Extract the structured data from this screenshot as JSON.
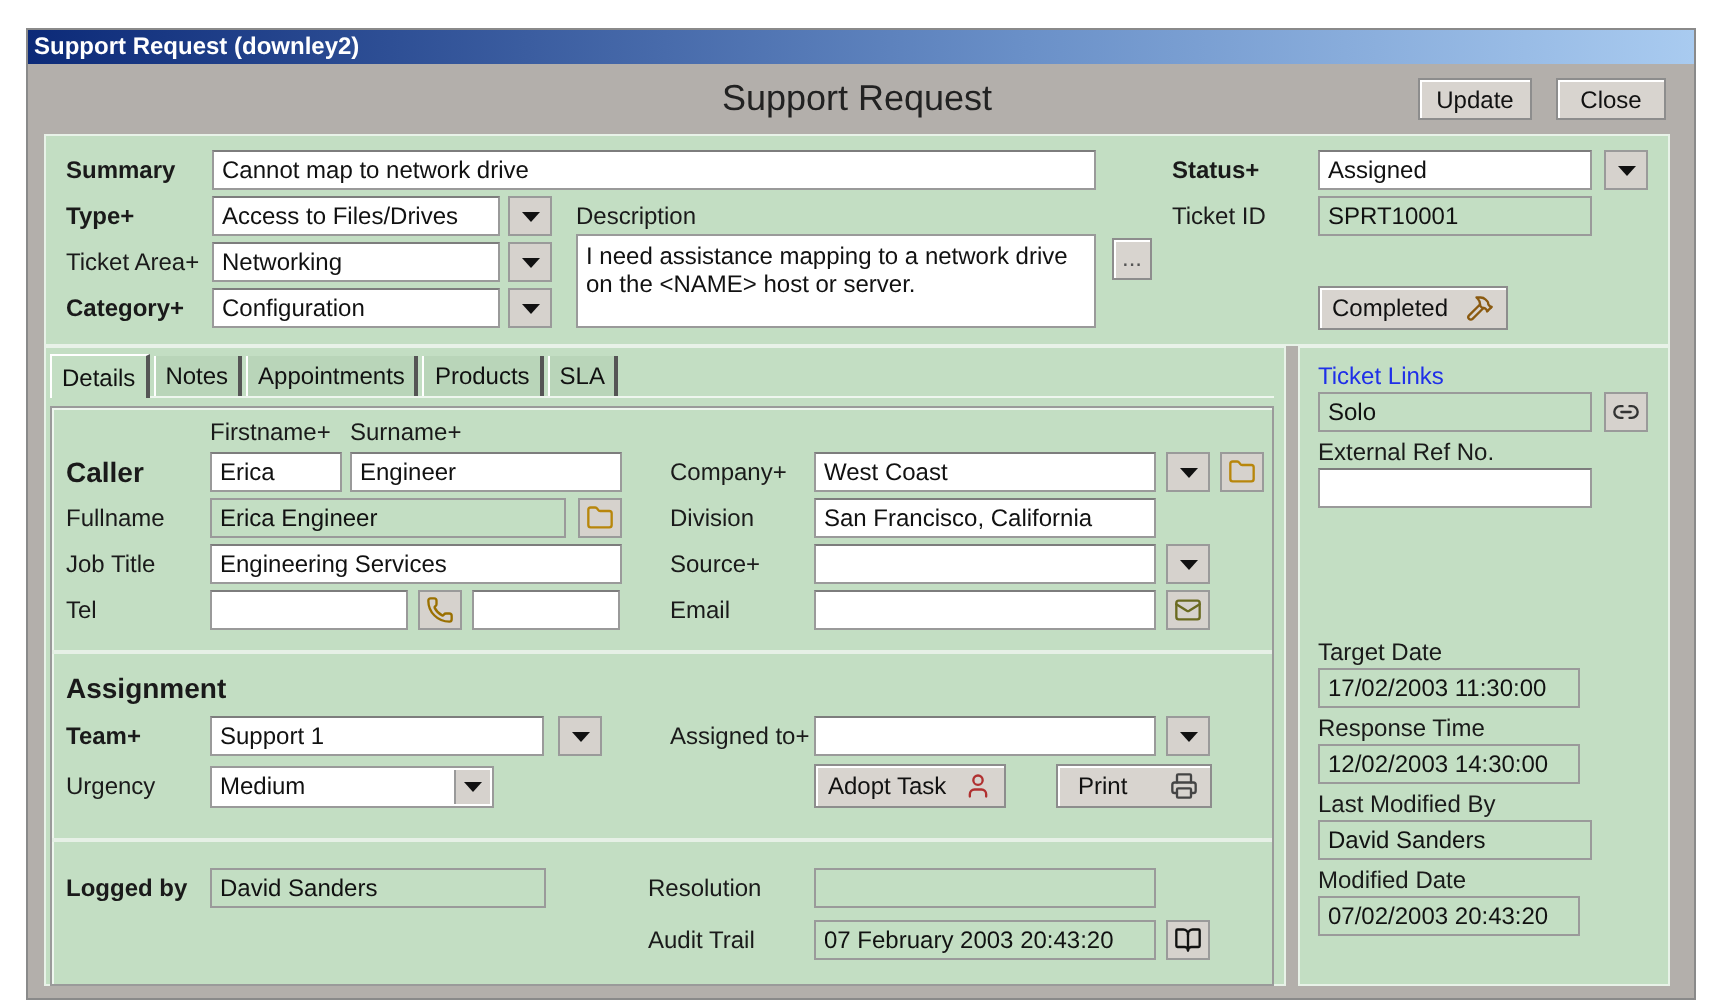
{
  "window": {
    "title": "Support Request (downley2)"
  },
  "header": {
    "title": "Support Request",
    "update_button": "Update",
    "close_button": "Close"
  },
  "summary": {
    "label": "Summary",
    "value": "Cannot map to network drive",
    "read_only": false
  },
  "type": {
    "label": "Type+",
    "value": "Access to Files/Drives",
    "read_only": false
  },
  "ticket_area": {
    "label": "Ticket Area+",
    "value": "Networking",
    "read_only": false
  },
  "category": {
    "label": "Category+",
    "value": "Configuration",
    "read_only": false
  },
  "description": {
    "label": "Description",
    "value": "I need assistance mapping to a network drive on the <NAME> host or server.",
    "read_only": false,
    "more_button": "..."
  },
  "status": {
    "label": "Status+",
    "value": "Assigned",
    "read_only": false
  },
  "ticket_id": {
    "label": "Ticket ID",
    "value": "SPRT10001",
    "read_only": true
  },
  "completed_button": "Completed",
  "tabs": [
    {
      "label": "Details",
      "selected": true
    },
    {
      "label": "Notes",
      "selected": false
    },
    {
      "label": "Appointments",
      "selected": false
    },
    {
      "label": "Products",
      "selected": false
    },
    {
      "label": "SLA",
      "selected": false
    }
  ],
  "caller": {
    "title": "Caller",
    "firstname": {
      "label": "Firstname+",
      "value": "Erica",
      "read_only": false
    },
    "surname": {
      "label": "Surname+",
      "value": "Engineer",
      "read_only": false
    },
    "fullname": {
      "label": "Fullname",
      "value": "Erica Engineer",
      "read_only": true
    },
    "job_title": {
      "label": "Job Title",
      "value": "Engineering Services",
      "read_only": false
    },
    "tel": {
      "label": "Tel",
      "read_only": false
    },
    "tel_2": {
      "read_only": false
    },
    "company": {
      "label": "Company+",
      "value": "West Coast",
      "read_only": false
    },
    "division": {
      "label": "Division",
      "value": "San Francisco, California",
      "read_only": false
    },
    "source": {
      "label": "Source+",
      "read_only": false
    },
    "email": {
      "label": "Email",
      "read_only": false
    }
  },
  "assignment": {
    "title": "Assignment",
    "team": {
      "label": "Team+",
      "value": "Support 1",
      "read_only": false
    },
    "urgency": {
      "label": "Urgency",
      "value": "Medium"
    },
    "assigned_to": {
      "label": "Assigned to+",
      "read_only": false
    },
    "adopt_button": "Adopt Task",
    "print_button": "Print"
  },
  "logging": {
    "logged_by": {
      "label": "Logged by",
      "value": "David Sanders",
      "read_only": true
    },
    "resolution": {
      "label": "Resolution",
      "read_only": true
    },
    "audit_trail": {
      "label": "Audit Trail",
      "value": "07 February 2003 20:43:20",
      "read_only": true
    }
  },
  "side": {
    "ticket_links": {
      "label": "Ticket Links",
      "value": "Solo",
      "read_only": true
    },
    "external_ref": {
      "label": "External Ref No.",
      "read_only": false
    },
    "target_date": {
      "label": "Target Date",
      "value": "17/02/2003 11:30:00",
      "read_only": true
    },
    "response_time": {
      "label": "Response Time",
      "value": "12/02/2003 14:30:00",
      "read_only": true
    },
    "last_modified_by": {
      "label": "Last Modified By",
      "value": "David Sanders",
      "read_only": true
    },
    "modified_date": {
      "label": "Modified Date",
      "value": "07/02/2003 20:43:20",
      "read_only": true
    }
  }
}
